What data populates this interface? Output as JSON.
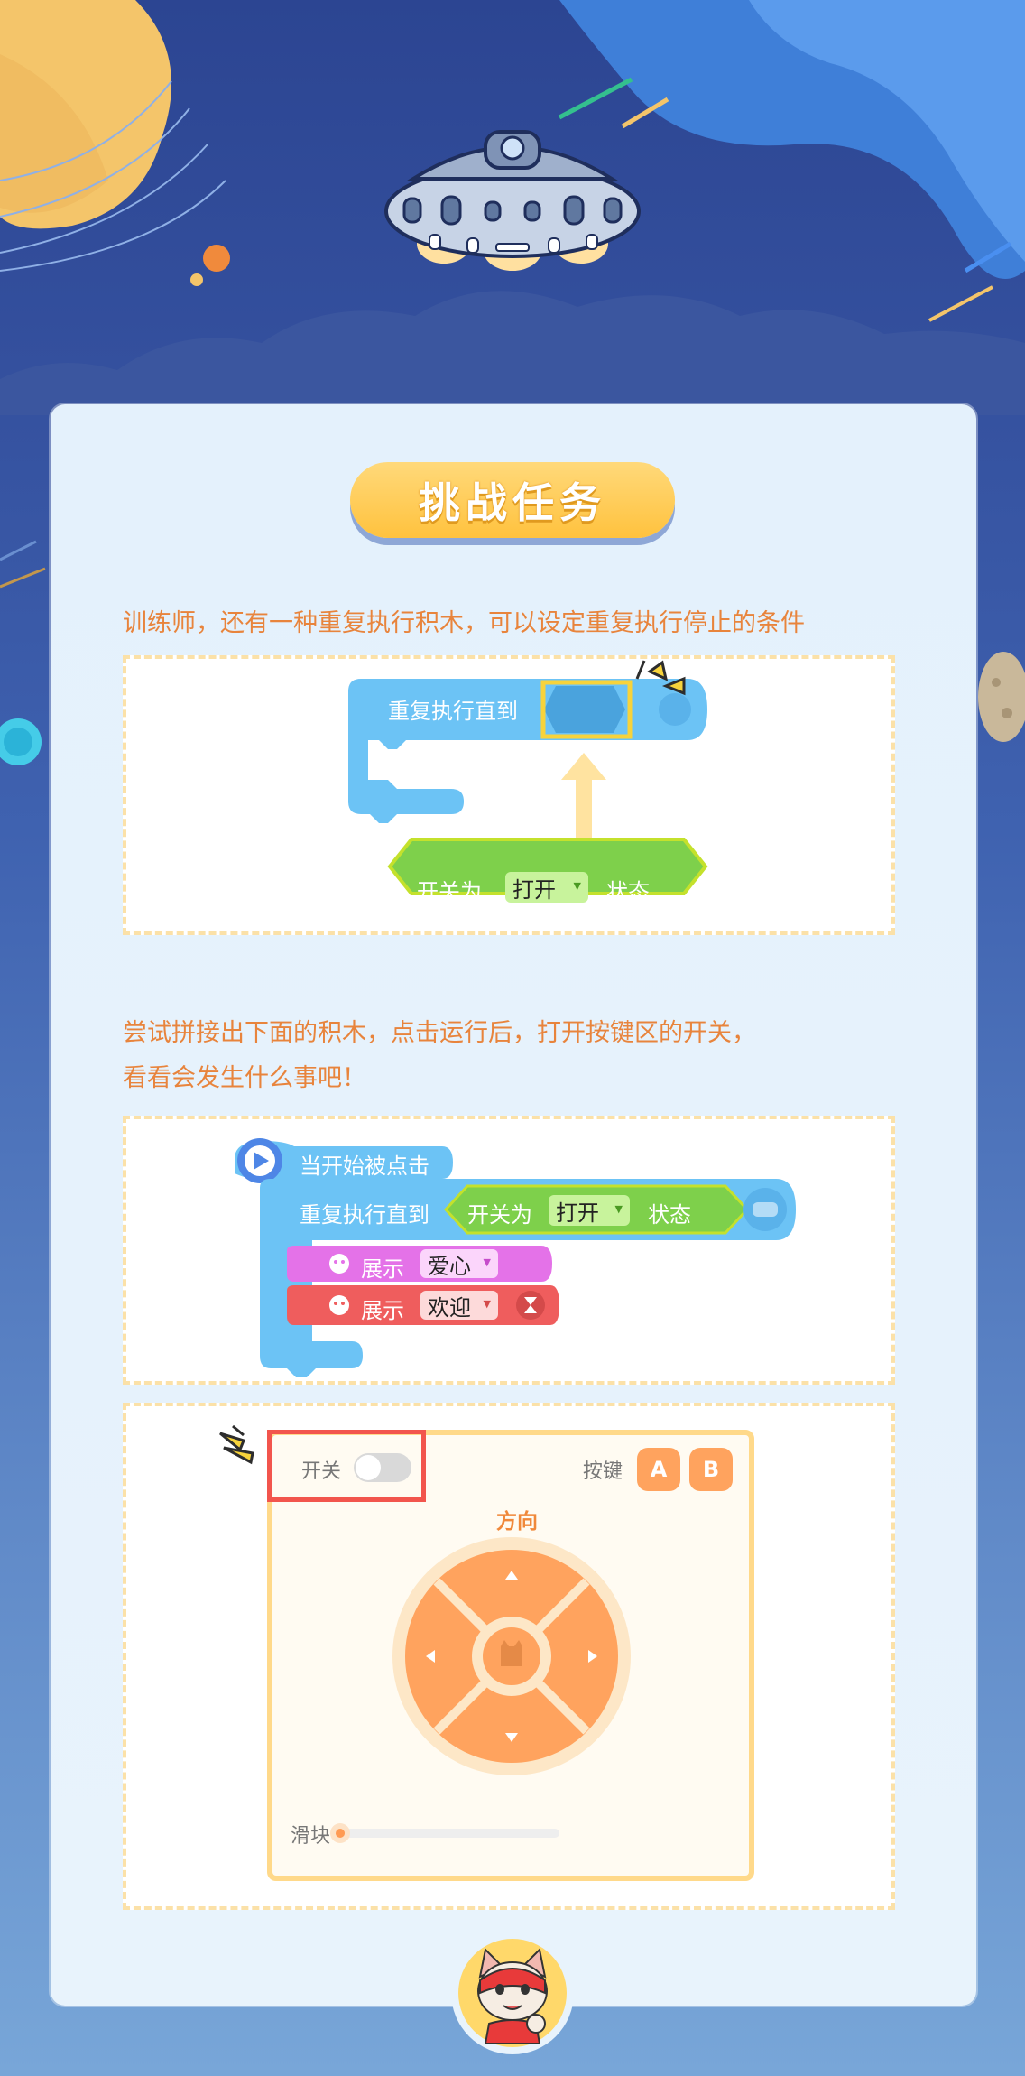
{
  "title": "挑战任务",
  "paragraph1": "训练师，还有一种重复执行积木，可以设定重复执行停止的条件",
  "paragraph2_line1": "尝试拼接出下面的积木，点击运行后，打开按键区的开关，",
  "paragraph2_line2": "看看会发生什么事吧！",
  "example1": {
    "repeat_label": "重复执行直到",
    "switch_label": "开关为",
    "switch_value": "打开",
    "switch_suffix": "状态"
  },
  "example2": {
    "start_label": "当开始被点击",
    "repeat_label": "重复执行直到",
    "switch_label": "开关为",
    "switch_value": "打开",
    "switch_suffix": "状态",
    "show1_label": "展示",
    "show1_value": "爱心",
    "show2_label": "展示",
    "show2_value": "欢迎"
  },
  "controller": {
    "switch_label": "开关",
    "keys_label": "按键",
    "key_a": "A",
    "key_b": "B",
    "direction_label": "方向",
    "slider_label": "滑块",
    "switch_on": false,
    "slider_value": 0
  },
  "colors": {
    "text_orange": "#e8843c",
    "repeat_blue": "#6cc3f5",
    "condition_green": "#7ed04b",
    "show_pink": "#e472e8",
    "show_red": "#ef5d5d",
    "pad_orange": "#ffa35e"
  }
}
